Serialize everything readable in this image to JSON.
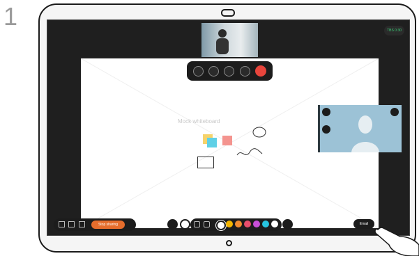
{
  "step": {
    "number": "1"
  },
  "call": {
    "timer": "TBS 0:30"
  },
  "whiteboard": {
    "label": "Mock whiteboard"
  },
  "toolbar": {
    "stop_sharing_label": "Stop sharing",
    "email_label": "Email"
  },
  "colors": {
    "end_call": "#e8453c",
    "stop_sharing": "#e66d2c",
    "swatches": [
      "#ffffff",
      "#f4b400",
      "#f28b30",
      "#e84d6c",
      "#c84fd8",
      "#27c5e0",
      "#3bd57a",
      "#ffffff"
    ],
    "sticky_yellow": "#f6d36b",
    "sticky_blue": "#5fd0e6",
    "sticky_red": "#f4948f"
  },
  "icons": {
    "call_controls": [
      "microphone-icon",
      "camera-icon",
      "share-icon",
      "more-icon",
      "end-call-icon"
    ],
    "remote_controls": [
      "camera-icon",
      "mute-icon",
      "fullscreen-icon"
    ],
    "bottom_left": [
      "page-icon",
      "folder-icon",
      "copy-icon"
    ],
    "tools": [
      "undo-icon",
      "pen-icon",
      "highlighter-icon",
      "eraser-icon",
      "sticky-note-icon"
    ]
  }
}
